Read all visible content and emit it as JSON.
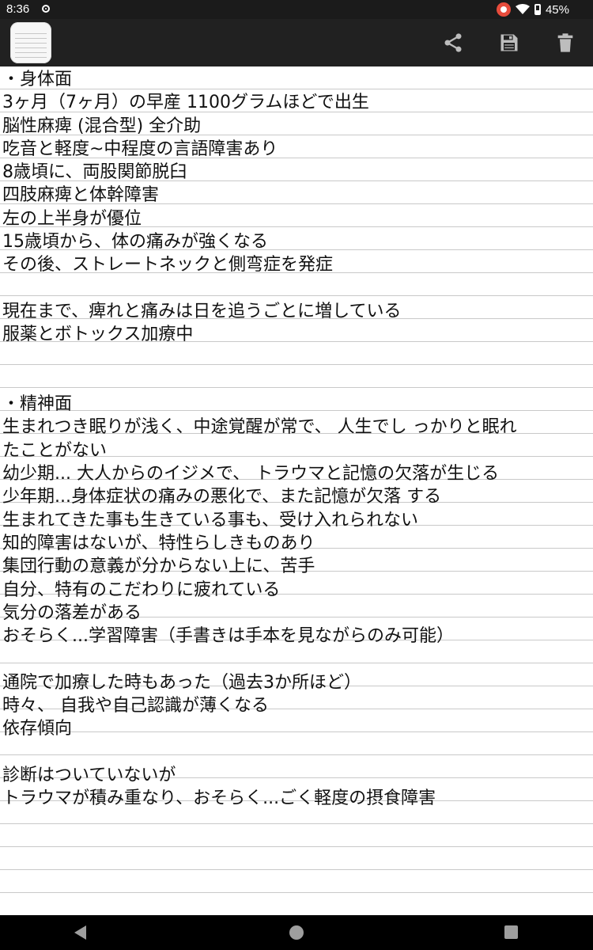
{
  "status_bar": {
    "time": "8:36",
    "battery": "45%"
  },
  "toolbar": {
    "icons": [
      "app-notepad-icon",
      "share-icon",
      "save-icon",
      "trash-icon"
    ]
  },
  "note": {
    "lines": [
      "・身体面",
      "3ヶ月（7ヶ月）の早産 1100グラムほどで出生",
      "脳性麻痺 (混合型) 全介助",
      "吃音と軽度~中程度の言語障害あり",
      "8歳頃に、両股関節脱臼",
      "四肢麻痺と体幹障害",
      "左の上半身が優位",
      "15歳頃から、体の痛みが強くなる",
      "その後、ストレートネックと側弯症を発症",
      "",
      "現在まで、痺れと痛みは日を追うごとに増している",
      "服薬とボトックス加療中",
      "",
      "",
      "・精神面",
      "生まれつき眠りが浅く、中途覚醒が常で、 人生でし っかりと眠れ",
      "たことがない",
      "幼少期... 大人からのイジメで、 トラウマと記憶の欠落が生じる",
      "少年期...身体症状の痛みの悪化で、また記憶が欠落 する",
      "生まれてきた事も生きている事も、受け入れられない",
      "知的障害はないが、特性らしきものあり",
      "集団行動の意義が分からない上に、苦手",
      "自分、特有のこだわりに疲れている",
      "気分の落差がある",
      "おそらく...学習障害（手書きは手本を見ながらのみ可能）",
      "",
      "通院で加療した時もあった（過去3か所ほど）",
      "時々、 自我や自己認識が薄くなる",
      "依存傾向",
      "",
      "診断はついていないが",
      "トラウマが積み重なり、おそらく...ごく軽度の摂食障害"
    ]
  },
  "colors": {
    "toolbar_bg": "#212121",
    "status_bg": "#1b1b1b",
    "paper_bg": "#ffffff",
    "rule_line": "#c9c9c9",
    "record_red": "#e74c3c"
  }
}
